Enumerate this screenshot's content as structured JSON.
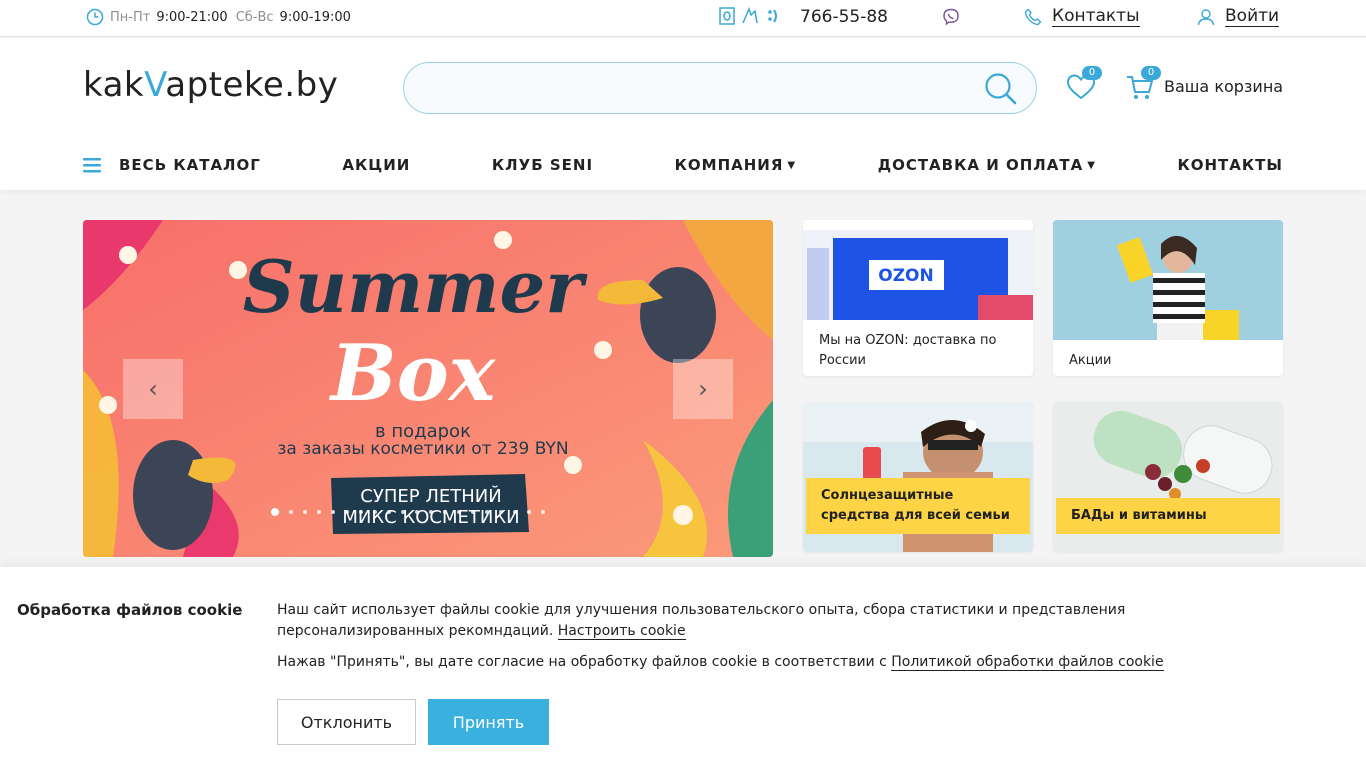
{
  "topbar": {
    "weekdays_label": "Пн-Пт",
    "weekdays_hours": "9:00-21:00",
    "weekend_label": "Сб-Вс",
    "weekend_hours": "9:00-19:00",
    "phone": "766-55-88",
    "contacts": "Контакты",
    "login": "Войти",
    "icons": [
      "clock-icon",
      "a1-operator-icon",
      "mts-operator-icon",
      "life-operator-icon",
      "viber-icon",
      "phone-icon",
      "user-icon"
    ]
  },
  "header": {
    "logo_prefix": "kak",
    "logo_accent": "V",
    "logo_suffix": "apteke.by",
    "search_placeholder": "",
    "favorites_count": "0",
    "cart_count": "0",
    "cart_label": "Ваша корзина"
  },
  "nav": {
    "items": [
      {
        "label": "ВЕСЬ КАТАЛОГ"
      },
      {
        "label": "АКЦИИ"
      },
      {
        "label": "КЛУБ SENI"
      },
      {
        "label": "КОМПАНИЯ"
      },
      {
        "label": "ДОСТАВКА И ОПЛАТА"
      },
      {
        "label": "КОНТАКТЫ"
      }
    ]
  },
  "slider": {
    "title_line1": "Summer",
    "title_line2": "Box",
    "subtitle1": "в подарок",
    "subtitle2": "за заказы косметики  от 239 BYN",
    "badge_line1": "СУПЕР ЛЕТНИЙ",
    "badge_line2": "МИКС КОСМЕТИКИ",
    "dots_count": 20,
    "active_dot": 0,
    "prev": "‹",
    "next": "›"
  },
  "tiles": [
    {
      "caption": "Мы на OZON: доставка по России",
      "image_text": "OZON"
    },
    {
      "caption": "Акции"
    },
    {
      "caption": "Солнцезащитные средства для всей семьи"
    },
    {
      "caption": "БАДы и витамины"
    }
  ],
  "cookie": {
    "title": "Обработка файлов cookie",
    "text": "Наш сайт использует файлы cookie для улучшения пользовательского опыта, сбора статистики и представления персонализированных рекомндаций.",
    "settings_link": "Настроить cookie",
    "consent_text": "Нажав \"Принять\", вы дате согласие на обработку файлов cookie в соответствии с",
    "policy_link": "Политикой обработки файлов cookie",
    "decline": "Отклонить",
    "accept": "Принять"
  },
  "colors": {
    "accent": "#3aa8d8",
    "banner": "#f78070",
    "yellow": "#fdd446",
    "navy": "#1f3a4d"
  }
}
